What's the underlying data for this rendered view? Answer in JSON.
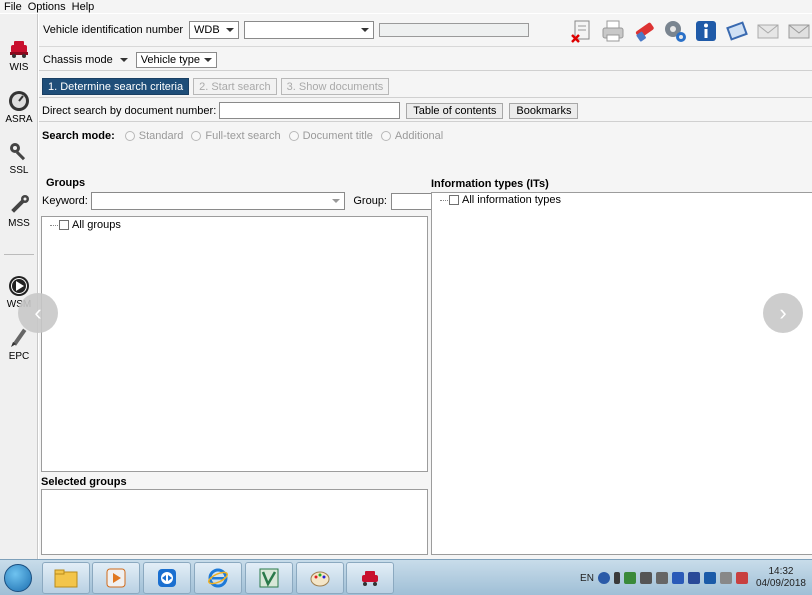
{
  "menu": [
    "File",
    "Options",
    "Help"
  ],
  "sidebar": [
    {
      "label": "WIS",
      "icon": "car-icon"
    },
    {
      "label": "ASRA",
      "icon": "speedometer-icon"
    },
    {
      "label": "SSL",
      "icon": "key-icon"
    },
    {
      "label": "MSS",
      "icon": "wrench-icon"
    },
    {
      "label": "WSM",
      "icon": "play-icon"
    },
    {
      "label": "EPC",
      "icon": "pen-icon"
    }
  ],
  "vin": {
    "label": "Vehicle identification number",
    "prefix": "WDB",
    "value": ""
  },
  "toolbar": [
    "delete-search-icon",
    "print-icon",
    "eraser-icon",
    "settings-icon",
    "info-icon",
    "book-icon",
    "mail-icon",
    "mail-alt-icon"
  ],
  "mode": {
    "chassis_label": "Chassis mode",
    "vehicle_type_label": "Vehicle type"
  },
  "steps": [
    {
      "label": "1. Determine search criteria",
      "active": true
    },
    {
      "label": "2. Start search",
      "active": false
    },
    {
      "label": "3. Show documents",
      "active": false
    }
  ],
  "direct": {
    "label": "Direct search by document number:",
    "value": "",
    "toc_label": "Table of contents",
    "bookmarks_label": "Bookmarks"
  },
  "search_mode": {
    "label": "Search mode:",
    "options": [
      "Standard",
      "Full-text search",
      "Document title",
      "Additional"
    ]
  },
  "groups": {
    "title": "Groups",
    "keyword_label": "Keyword:",
    "group_label": "Group:",
    "all_groups": "All groups",
    "selected_title": "Selected groups"
  },
  "info_types": {
    "title": "Information types (ITs)",
    "all": "All information types"
  },
  "taskbar": {
    "lang": "EN",
    "time": "14:32",
    "date": "04/09/2018"
  }
}
